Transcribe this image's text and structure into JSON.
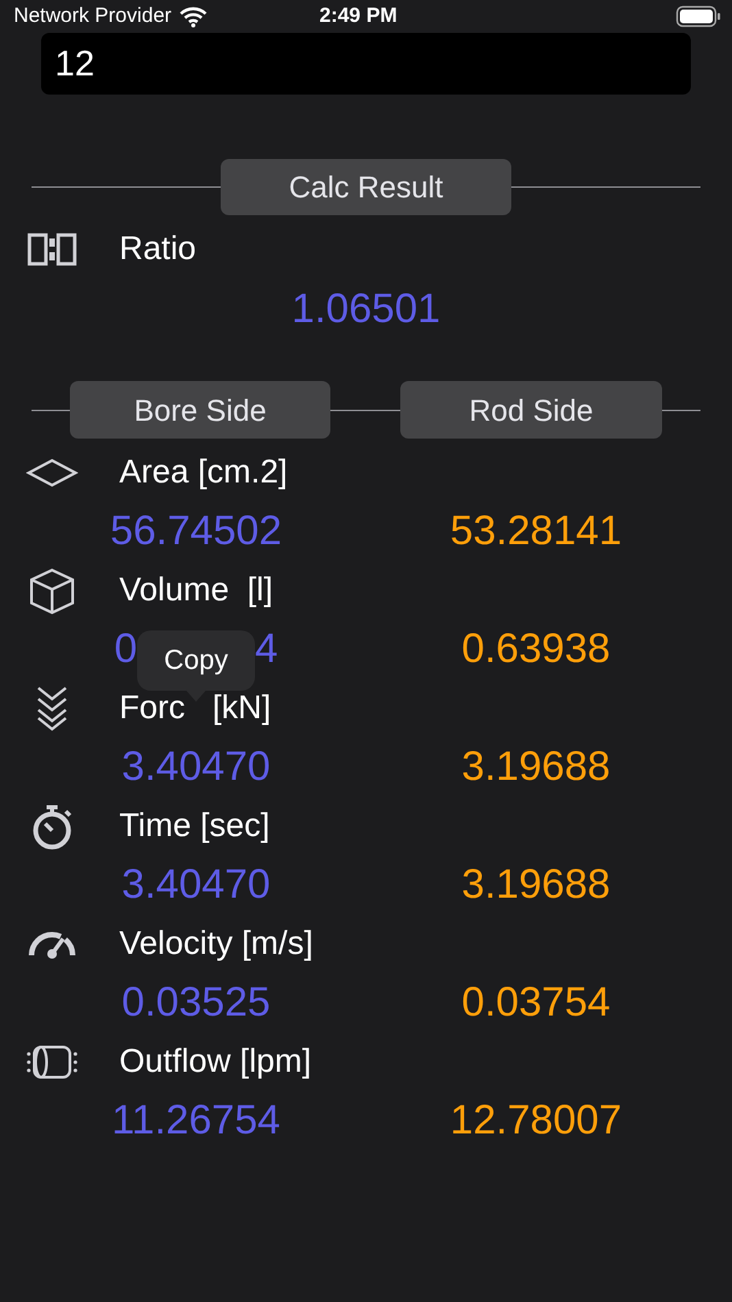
{
  "status_bar": {
    "carrier": "Network Provider",
    "time": "2:49 PM"
  },
  "oil_flow": {
    "value": "12"
  },
  "calc_result": {
    "label": "Calc Result"
  },
  "ratio": {
    "label": "Ratio",
    "value": "1.06501"
  },
  "sides": [
    "Bore Side",
    "Rod Side"
  ],
  "rows": [
    {
      "kind": "area",
      "label": "Area [cm.2]",
      "bore": "56.74502",
      "rod": "53.28141"
    },
    {
      "kind": "volume",
      "label": "Volume  [l]",
      "bore_parts": [
        "0",
        "4"
      ],
      "rod": "0.63938"
    },
    {
      "kind": "force",
      "label_parts": [
        "Forc",
        "[kN]"
      ],
      "bore": "3.40470",
      "rod": "3.19688"
    },
    {
      "kind": "time",
      "label": "Time [sec]",
      "bore": "3.40470",
      "rod": "3.19688"
    },
    {
      "kind": "velocity",
      "label": "Velocity [m/s]",
      "bore": "0.03525",
      "rod": "0.03754"
    },
    {
      "kind": "outflow",
      "label": "Outflow [lpm]",
      "bore": "11.26754",
      "rod": "12.78007"
    }
  ],
  "tooltip": {
    "label": "Copy"
  }
}
